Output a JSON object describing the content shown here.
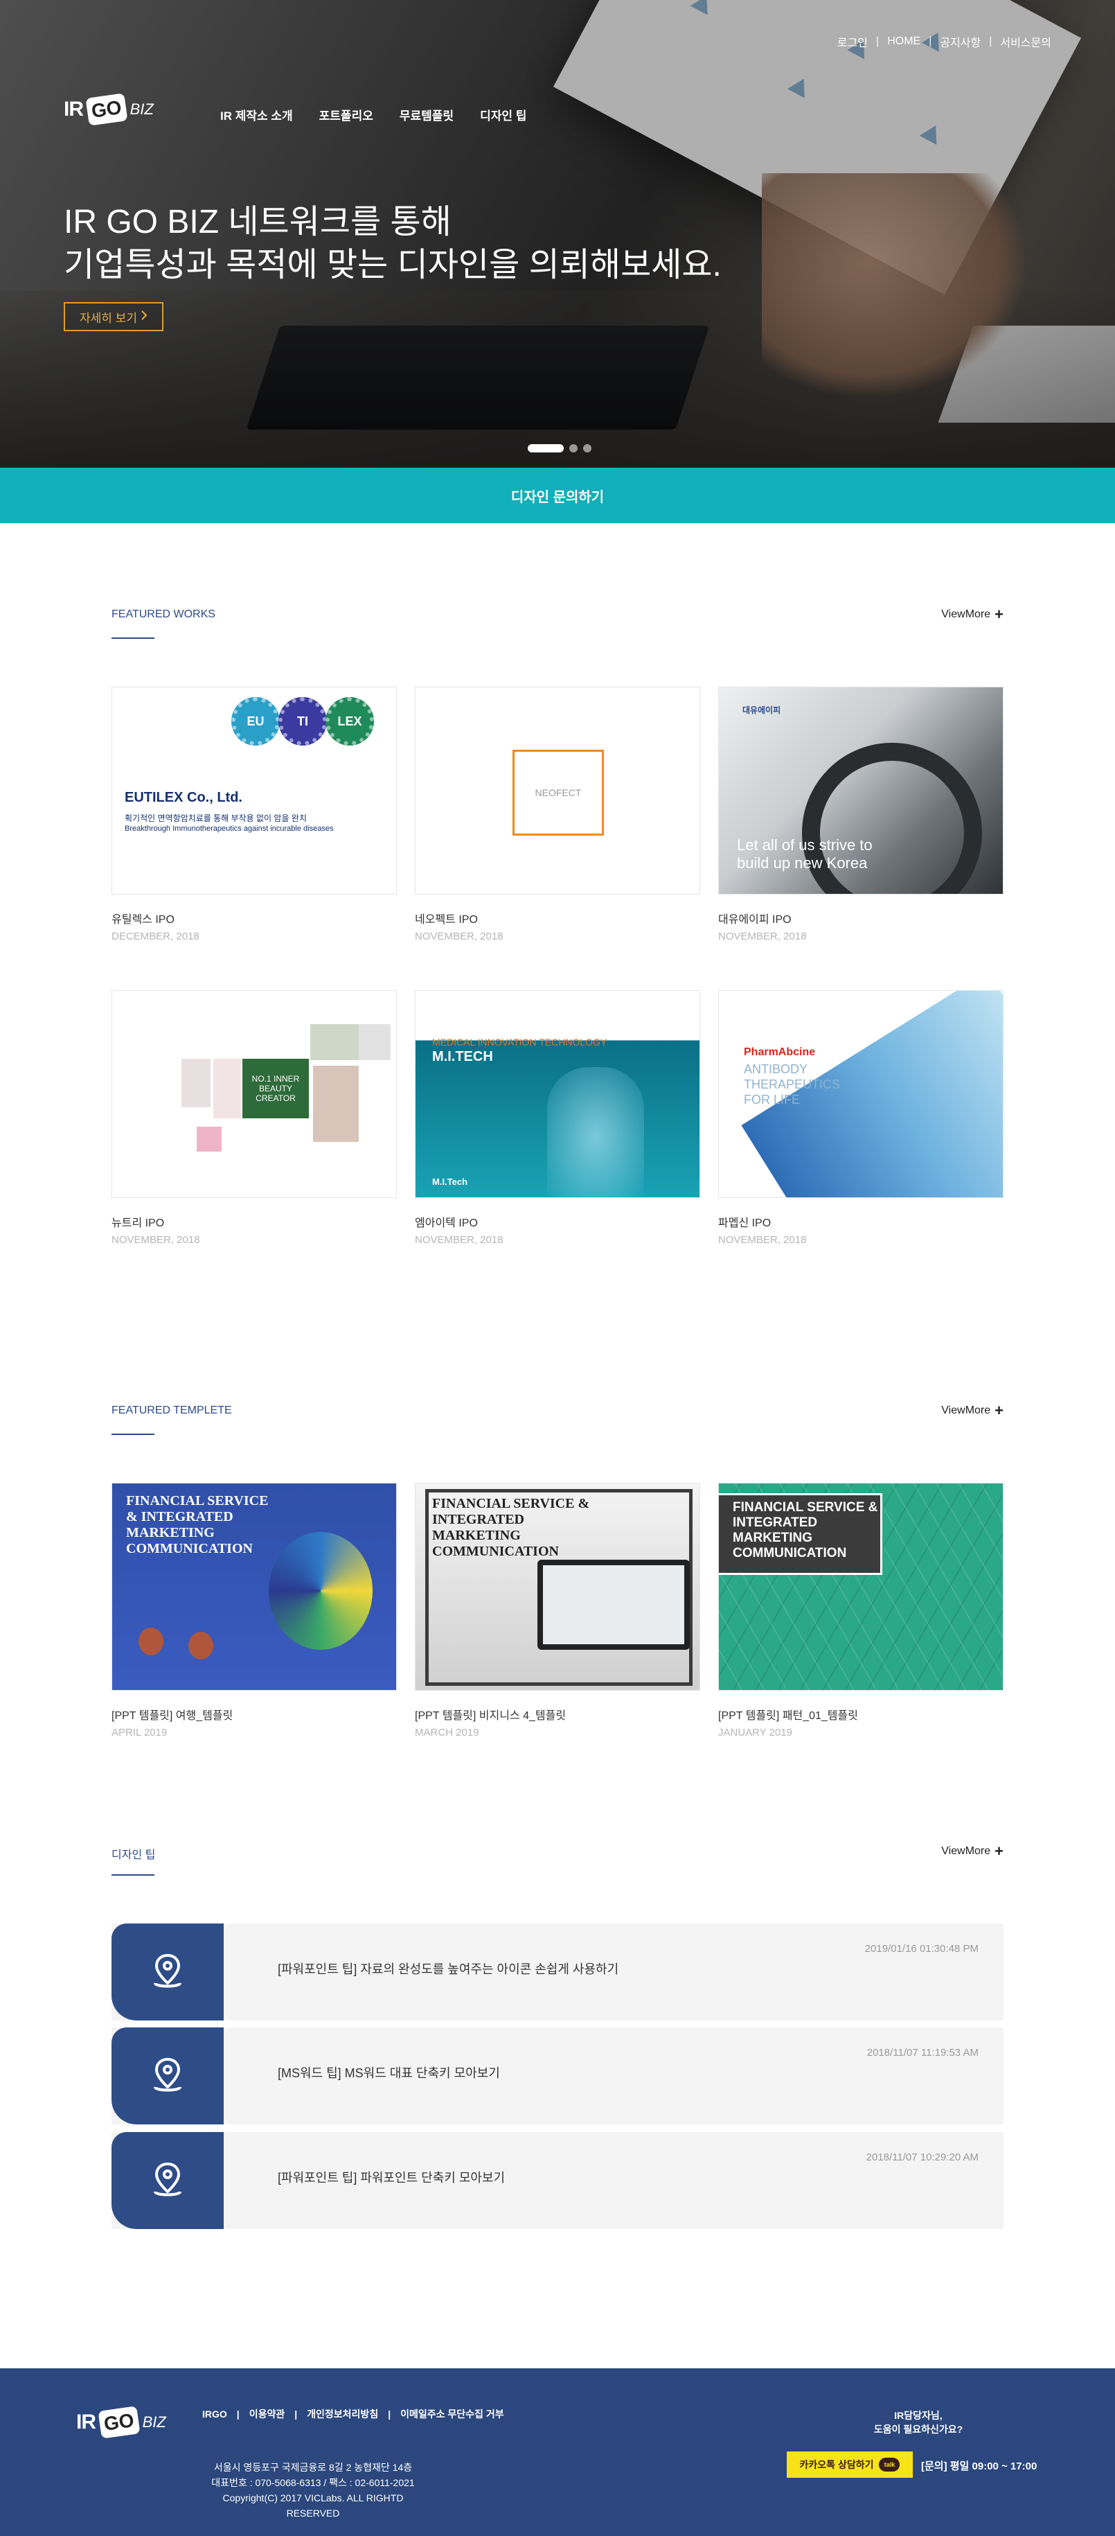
{
  "topnav": {
    "items": [
      "로그인",
      "HOME",
      "공지사항",
      "서비스문의"
    ]
  },
  "logo": {
    "ir": "IR",
    "go": "GO",
    "biz": "BIZ"
  },
  "mainnav": {
    "items": [
      "IR 제작소 소개",
      "포트폴리오",
      "무료템플릿",
      "디자인 팁"
    ]
  },
  "hero": {
    "line1": "IR GO BIZ 네트워크를 통해",
    "line2": "기업특성과 목적에 맞는 디자인을 의뢰해보세요.",
    "button": "자세히 보기",
    "button_icon": "chevron-right-icon"
  },
  "inquiry": {
    "label": "디자인 문의하기"
  },
  "works": {
    "title": "FEATURED WORKS",
    "viewmore": "ViewMore",
    "items": [
      {
        "title": "유틸렉스 IPO",
        "date": "DECEMBER, 2018",
        "art_brand": "EUTILEX Co., Ltd.",
        "art_sub": "획기적인 면역항암치료를 통해 부작용 없이 암을 완치",
        "art_sub2": "Breakthrough Immunotherapeutics against incurable diseases",
        "circles": [
          "EU",
          "TI",
          "LEX"
        ]
      },
      {
        "title": "네오펙트 IPO",
        "date": "NOVEMBER, 2018",
        "art_text": "NEOFECT"
      },
      {
        "title": "대유에이피 IPO",
        "date": "NOVEMBER, 2018",
        "art_corp": "대유에이피",
        "art_slogan": "Let all of us strive to build up new Korea"
      },
      {
        "title": "뉴트리 IPO",
        "date": "NOVEMBER, 2018",
        "art_text": "NO.1 INNER BEAUTY CREATOR"
      },
      {
        "title": "엠아이텍 IPO",
        "date": "NOVEMBER, 2018",
        "art_head1": "MEDICAL INNOVATION TECHNOLOGY",
        "art_head2": "M.I.TECH",
        "art_foot": "M.I.Tech"
      },
      {
        "title": "파멥신 IPO",
        "date": "NOVEMBER, 2018",
        "art_brand": "PharmAbcine",
        "art_tag": "ANTIBODY THERAPEUTICS FOR LIFE"
      }
    ]
  },
  "templates": {
    "title": "FEATURED TEMPLETE",
    "viewmore": "ViewMore",
    "items": [
      {
        "title": "[PPT 템플릿] 여행_템플릿",
        "date": "APRIL 2019",
        "art": "FINANCIAL SERVICE & INTEGRATED MARKETING COMMUNICATION"
      },
      {
        "title": "[PPT 템플릿] 비지니스 4_템플릿",
        "date": "MARCH 2019",
        "art": "FINANCIAL SERVICE & INTEGRATED MARKETING COMMUNICATION"
      },
      {
        "title": "[PPT 템플릿] 패턴_01_템플릿",
        "date": "JANUARY 2019",
        "art": "FINANCIAL SERVICE & INTEGRATED MARKETING COMMUNICATION"
      }
    ]
  },
  "tips": {
    "title": "디자인 팁",
    "viewmore": "ViewMore",
    "items": [
      {
        "title": "[파워포인트 팁] 자료의 완성도를 높여주는 아이콘 손쉽게 사용하기",
        "date": "2019/01/16 01:30:48 PM",
        "icon": "location-pin-icon"
      },
      {
        "title": "[MS워드 팁] MS워드 대표 단축키 모아보기",
        "date": "2018/11/07 11:19:53 AM",
        "icon": "location-pin-icon"
      },
      {
        "title": "[파워포인트 팁] 파워포인트 단축키 모아보기",
        "date": "2018/11/07 10:29:20 AM",
        "icon": "location-pin-icon"
      }
    ]
  },
  "footer": {
    "links": [
      "IRGO",
      "이용약관",
      "개인정보처리방침",
      "이메일주소 무단수집 거부"
    ],
    "address": "서울시 영등포구 국제금융로 8길 2 농협재단 14층",
    "phone": "대표번호 : 070-5068-6313 / 팩스 : 02-6011-2021",
    "copyright": "Copyright(C) 2017 VICLabs. ALL RIGHTD RESERVED",
    "question_line1": "IR담당자님,",
    "question_line2": "도움이 필요하신가요?",
    "kakao_label": "카카오톡 상담하기",
    "kakao_badge": "talk",
    "hours": "[문의] 평일 09:00 ~ 17:00"
  },
  "colors": {
    "accent": "#10afb9",
    "brand_blue": "#2b4a8c",
    "footer_bg": "#2b477d",
    "button_gold": "#d8a02c",
    "kakao_yellow": "#f7e317"
  }
}
